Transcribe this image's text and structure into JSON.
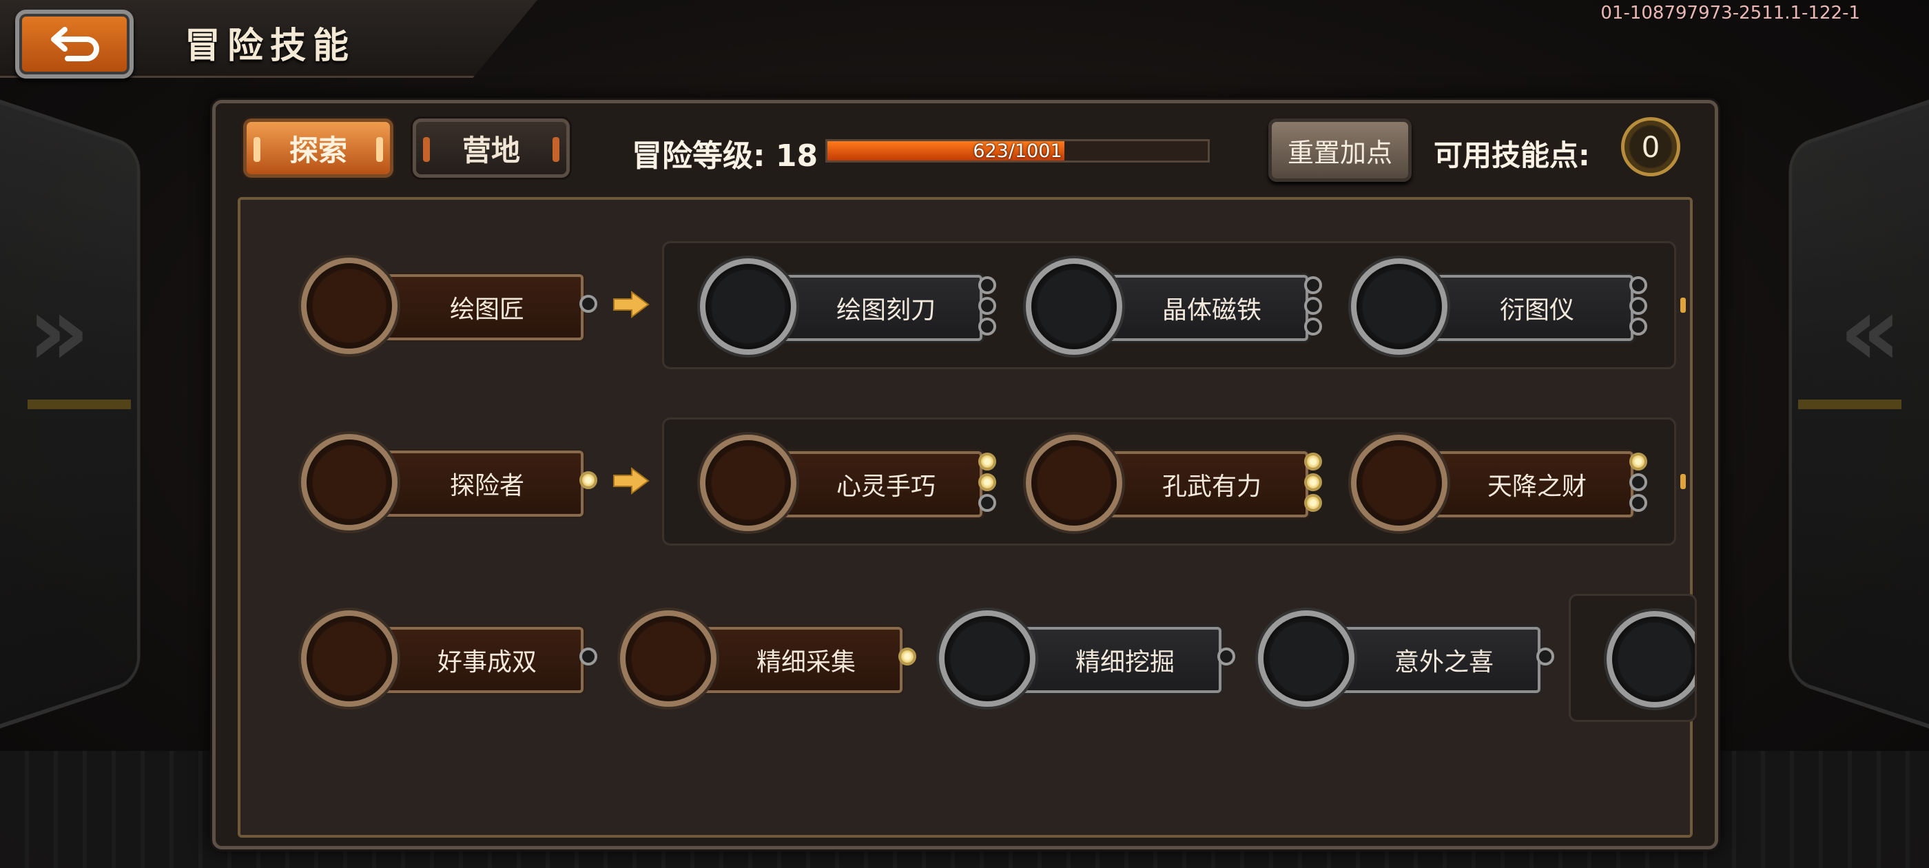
{
  "title": "冒险技能",
  "version": "01-108797973-2511.1-122-1",
  "tabs": [
    {
      "label": "探索",
      "active": true
    },
    {
      "label": "营地",
      "active": false
    }
  ],
  "level": {
    "label": "冒险等级: 18",
    "xp_text": "623/1001",
    "current": 623,
    "max": 1001
  },
  "reset_label": "重置加点",
  "points": {
    "label": "可用技能点:",
    "value": "0"
  },
  "rows": [
    {
      "root": {
        "name": "绘图匠",
        "state": "learned",
        "dots": [
          "off"
        ]
      },
      "children": [
        {
          "name": "绘图刻刀",
          "state": "locked",
          "dots": [
            "off",
            "off",
            "off"
          ]
        },
        {
          "name": "晶体磁铁",
          "state": "locked",
          "dots": [
            "off",
            "off",
            "off"
          ]
        },
        {
          "name": "衍图仪",
          "state": "locked",
          "dots": [
            "off",
            "off",
            "off"
          ]
        }
      ]
    },
    {
      "root": {
        "name": "探险者",
        "state": "learned",
        "dots": [
          "on"
        ]
      },
      "children": [
        {
          "name": "心灵手巧",
          "state": "learned",
          "dots": [
            "on",
            "on",
            "off"
          ]
        },
        {
          "name": "孔武有力",
          "state": "learned",
          "dots": [
            "on",
            "on",
            "on"
          ]
        },
        {
          "name": "天降之财",
          "state": "learned",
          "dots": [
            "on",
            "off",
            "off"
          ]
        }
      ]
    },
    {
      "items": [
        {
          "name": "好事成双",
          "state": "learned",
          "dots": [
            "off"
          ]
        },
        {
          "name": "精细采集",
          "state": "learned",
          "dots": [
            "on"
          ]
        },
        {
          "name": "精细挖掘",
          "state": "locked",
          "dots": [
            "off"
          ]
        },
        {
          "name": "意外之喜",
          "state": "locked",
          "dots": [
            "off"
          ]
        }
      ]
    }
  ],
  "icons": {
    "back": "return-arrow-icon",
    "arrow": "right-arrow-icon"
  },
  "colors": {
    "accent": "#e27a24",
    "learned_dot": "#e8c86a",
    "panel": "#221c19"
  }
}
